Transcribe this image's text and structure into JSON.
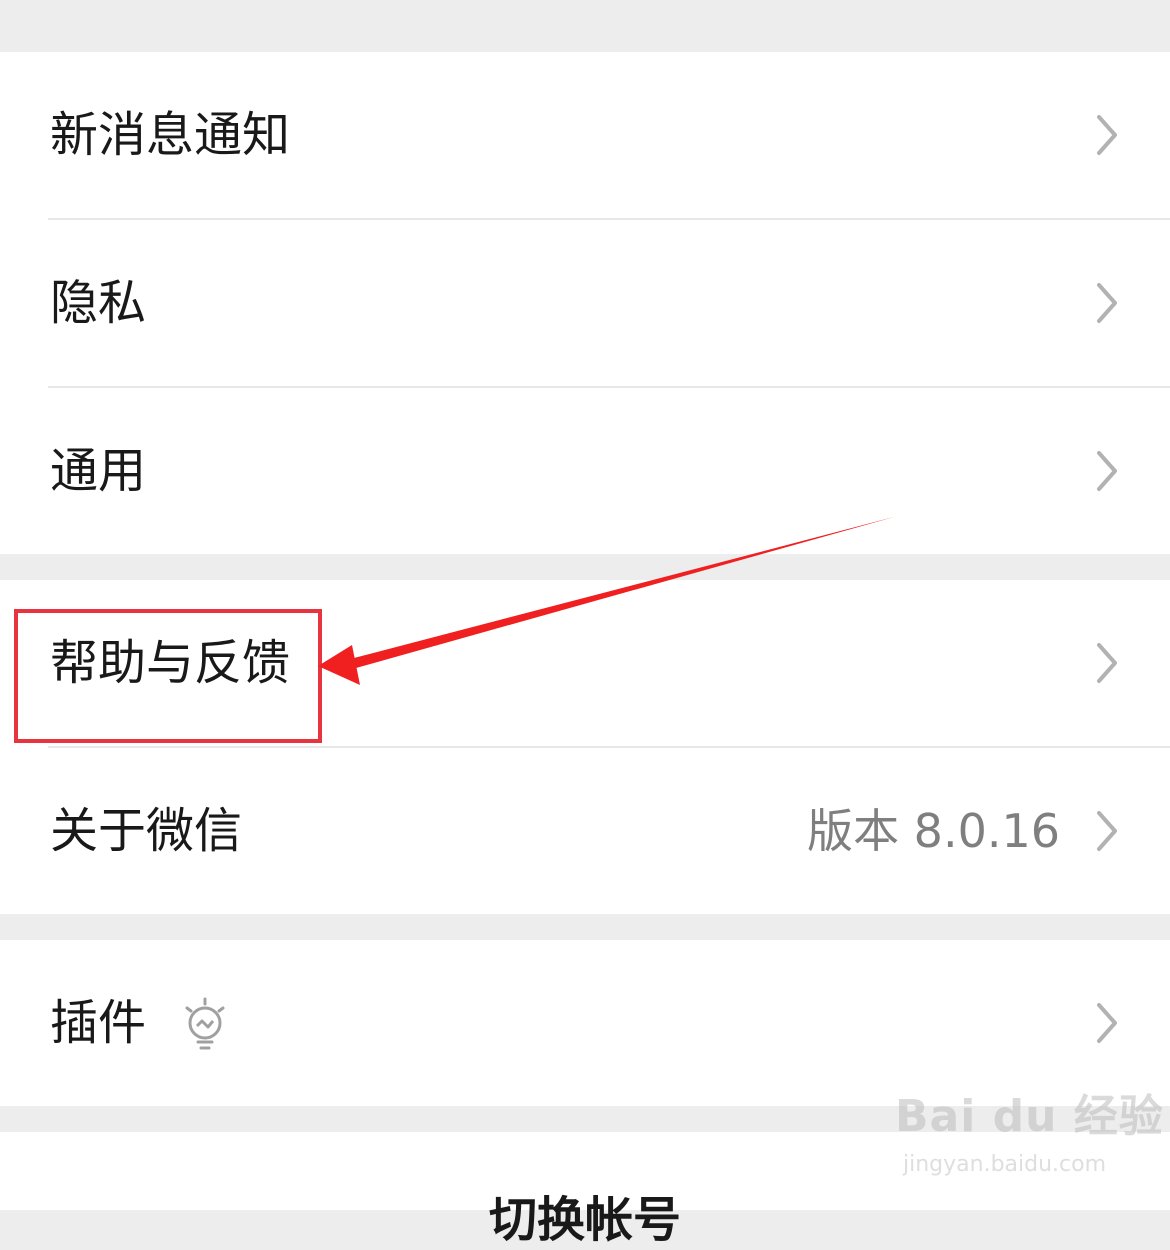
{
  "groups": [
    {
      "items": [
        {
          "label": "新消息通知"
        },
        {
          "label": "隐私"
        },
        {
          "label": "通用"
        }
      ]
    },
    {
      "items": [
        {
          "label": "帮助与反馈"
        },
        {
          "label": "关于微信",
          "value": "版本 8.0.16"
        }
      ]
    },
    {
      "items": [
        {
          "label": "插件",
          "icon": "lightbulb-icon"
        }
      ]
    }
  ],
  "bottom": {
    "label": "切换帐号"
  },
  "annotation": {
    "highlight_color": "#e8343f",
    "arrow_color": "#f02020",
    "target": "帮助与反馈"
  },
  "watermark": {
    "brand": "Bai du 经验",
    "url": "jingyan.baidu.com"
  },
  "colors": {
    "background": "#ededed",
    "row": "#ffffff",
    "text": "#191919",
    "secondary_text": "#7f7f7f",
    "chevron": "#b2b2b2"
  }
}
